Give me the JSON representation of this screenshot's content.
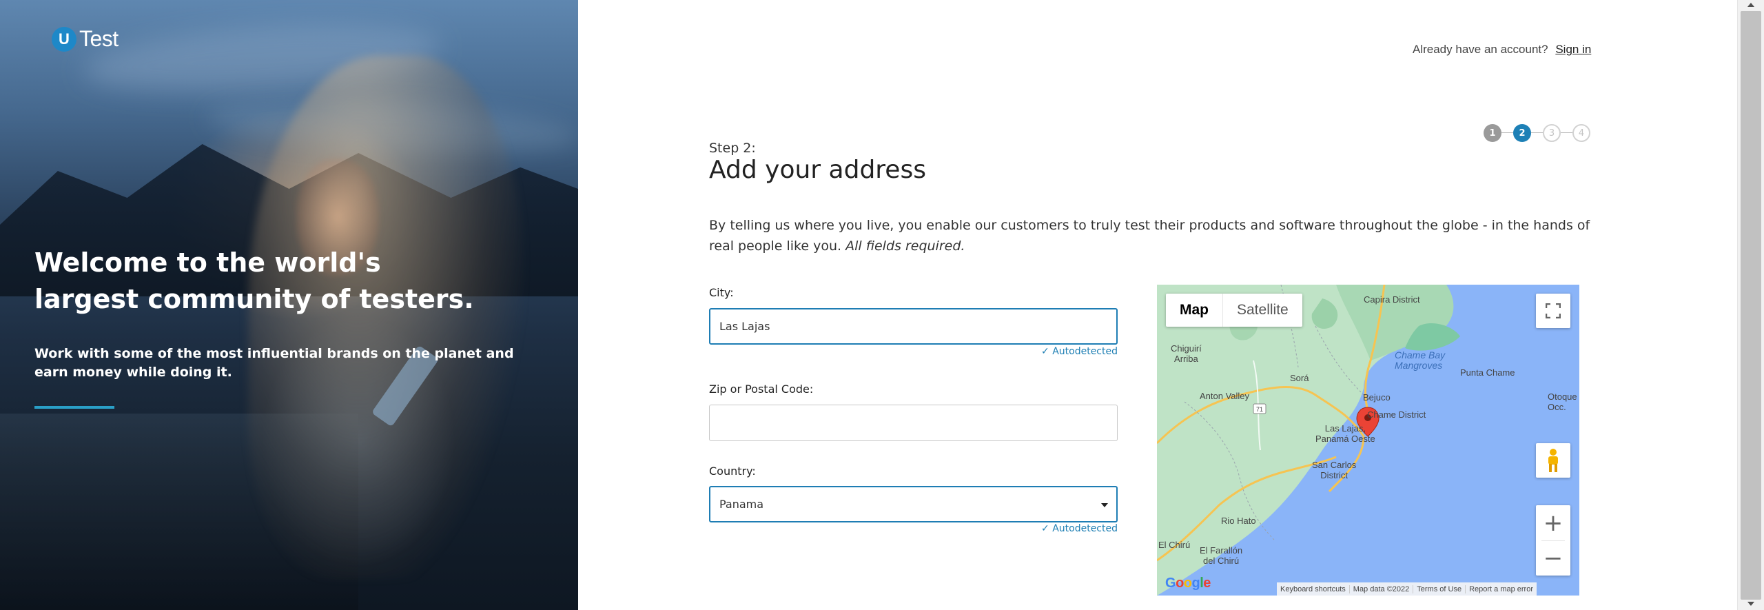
{
  "brand": {
    "logo_letter": "U",
    "logo_text": "Test"
  },
  "hero": {
    "title": "Welcome to the world's largest community of testers.",
    "subtitle": "Work with some of the most influential brands on the planet and earn money while doing it."
  },
  "header": {
    "have_account": "Already have an account?",
    "sign_in": "Sign in"
  },
  "steps": [
    {
      "label": "1",
      "state": "done"
    },
    {
      "label": "2",
      "state": "active"
    },
    {
      "label": "3",
      "state": "todo"
    },
    {
      "label": "4",
      "state": "todo"
    }
  ],
  "form": {
    "step_label": "Step 2:",
    "title": "Add your address",
    "intro": "By telling us where you live, you enable our customers to truly test their products and software throughout the globe - in the hands of real people like you.",
    "intro_required": "All fields required.",
    "city": {
      "label": "City:",
      "value": "Las Lajas",
      "autodetected": "✓ Autodetected"
    },
    "zip": {
      "label": "Zip or Postal Code:",
      "value": ""
    },
    "country": {
      "label": "Country:",
      "value": "Panama",
      "autodetected": "✓ Autodetected"
    }
  },
  "map": {
    "type_map": "Map",
    "type_satellite": "Satellite",
    "zoom_in": "+",
    "zoom_out": "−",
    "fullscreen_icon": "fullscreen-icon",
    "pegman_icon": "pegman-icon",
    "route_shield": "71",
    "places": {
      "capira": "Capira District",
      "chiguiri": "Chiguirí\nArriba",
      "chame_bay": "Chame Bay\nMangroves",
      "punta_chame": "Punta Chame",
      "sora": "Sorá",
      "anton_valley": "Anton Valley",
      "bejuco": "Bejuco",
      "chame_district": "Chame District",
      "otoque": "Otoque\nOcc.",
      "las_lajas": "Las Lajas,\nPanamá Oeste",
      "san_carlos": "San Carlos\nDistrict",
      "rio_hato": "Rio Hato",
      "el_chiru": "El Chirú",
      "el_farallon": "El Farallón\ndel Chirú"
    },
    "attribution": {
      "keyboard": "Keyboard shortcuts",
      "data": "Map data ©2022",
      "terms": "Terms of Use",
      "report": "Report a map error"
    },
    "google_letters": [
      "G",
      "o",
      "o",
      "g",
      "l",
      "e"
    ],
    "colors": {
      "water": "#8ab4f8",
      "land": "#bfe3c6",
      "road": "#f6c452",
      "pin": "#ea4335"
    }
  },
  "colors": {
    "accent": "#1d80b6",
    "hero_rule": "#2a9fc7"
  }
}
